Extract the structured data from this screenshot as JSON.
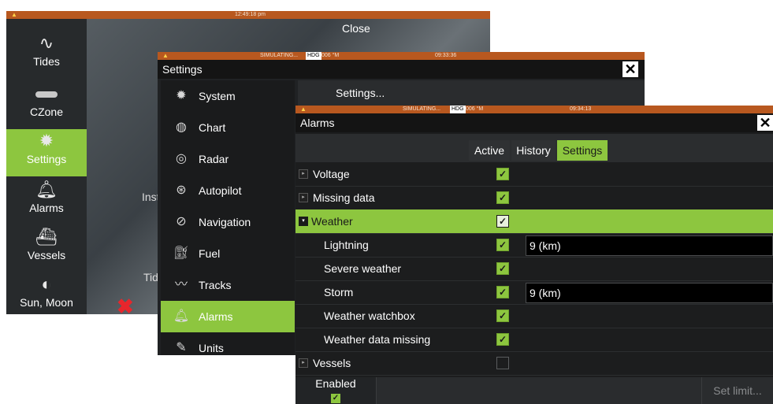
{
  "w1": {
    "status_time": "12:49:18 pm",
    "close_label": "Close",
    "sidebar": [
      {
        "label": "Tides",
        "icon": "tide-icon"
      },
      {
        "label": "CZone",
        "icon": "czone-icon"
      },
      {
        "label": "Settings",
        "icon": "gear-icon"
      },
      {
        "label": "Alarms",
        "icon": "bell-icon"
      },
      {
        "label": "Vessels",
        "icon": "vessels-icon"
      },
      {
        "label": "Sun, Moon",
        "icon": "sun-moon-icon"
      }
    ],
    "partial_labels": [
      "Inst",
      "Tid"
    ]
  },
  "w2": {
    "status_simulating": "SIMULATING...",
    "status_hdg": "HDG",
    "status_heading": "006 °M",
    "status_time": "09:33:36",
    "title": "Settings",
    "panel_text": "Settings...",
    "menu": [
      {
        "label": "System",
        "icon": "gear-icon"
      },
      {
        "label": "Chart",
        "icon": "globe-icon"
      },
      {
        "label": "Radar",
        "icon": "radar-icon"
      },
      {
        "label": "Autopilot",
        "icon": "autopilot-icon"
      },
      {
        "label": "Navigation",
        "icon": "compass-icon"
      },
      {
        "label": "Fuel",
        "icon": "fuel-icon"
      },
      {
        "label": "Tracks",
        "icon": "tracks-icon"
      },
      {
        "label": "Alarms",
        "icon": "bell-icon"
      },
      {
        "label": "Units",
        "icon": "pencil-icon"
      }
    ]
  },
  "w3": {
    "status_simulating": "SIMULATING...",
    "status_hdg": "HDG",
    "status_heading": "006 °M",
    "status_time": "09:34:13",
    "title": "Alarms",
    "tabs": [
      "Active",
      "History",
      "Settings"
    ],
    "rows": [
      {
        "name": "Voltage",
        "checked": true,
        "value": ""
      },
      {
        "name": "Missing data",
        "checked": true,
        "value": ""
      },
      {
        "name": "Weather",
        "checked": true,
        "value": ""
      },
      {
        "name": "Lightning",
        "checked": true,
        "value": "9 (km)"
      },
      {
        "name": "Severe weather",
        "checked": true,
        "value": ""
      },
      {
        "name": "Storm",
        "checked": true,
        "value": "9 (km)"
      },
      {
        "name": "Weather watchbox",
        "checked": true,
        "value": ""
      },
      {
        "name": "Weather data missing",
        "checked": true,
        "value": ""
      },
      {
        "name": "Vessels",
        "checked": false,
        "value": ""
      }
    ],
    "footer_enabled": "Enabled",
    "footer_setlimit": "Set limit...",
    "check_glyph": "✓"
  },
  "colors": {
    "accent": "#8dc63f",
    "statusbar": "#b8581f"
  }
}
